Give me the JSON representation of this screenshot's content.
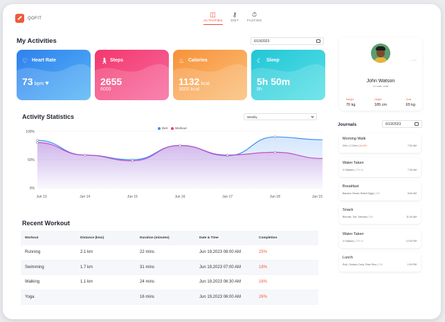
{
  "brand": {
    "name": "QOFIT"
  },
  "nav": [
    {
      "label": "ACTIVITIES",
      "icon": "dumbbell-icon",
      "active": true
    },
    {
      "label": "DIET",
      "icon": "fork-knife-icon",
      "active": false
    },
    {
      "label": "FASTING",
      "icon": "stopwatch-icon",
      "active": false
    }
  ],
  "activities": {
    "title": "My Activities",
    "date": "6/19/2023",
    "cards": [
      {
        "label": "Heart Rate",
        "value": "73",
        "unit": "bpm",
        "sub": "",
        "icon": "heart-icon",
        "color1": "#2f80ed",
        "color2": "#56b6f7"
      },
      {
        "label": "Steps",
        "value": "2655",
        "unit": "",
        "sub": "6000",
        "icon": "walking-icon",
        "color1": "#f2386e",
        "color2": "#f86aa0"
      },
      {
        "label": "Calories",
        "value": "1132",
        "unit": "kcal",
        "sub": "3000 kcal",
        "icon": "flame-icon",
        "color1": "#f7923a",
        "color2": "#fbc07a"
      },
      {
        "label": "Sleep",
        "value": "5h 50m",
        "unit": "",
        "sub": "8h",
        "icon": "moon-icon",
        "color1": "#22c6d6",
        "color2": "#58e0e6"
      }
    ]
  },
  "stats": {
    "title": "Activity Statistics",
    "period": "Weekly"
  },
  "chart_data": {
    "type": "area",
    "categories": [
      "Jun 13",
      "Jun 14",
      "Jun 15",
      "Jun 16",
      "Jun 17",
      "Jun 18",
      "Jun 15"
    ],
    "series": [
      {
        "name": "Diet",
        "color": "#3d8ff0",
        "values": [
          84,
          58,
          50,
          75,
          57,
          90,
          85
        ]
      },
      {
        "name": "Workout",
        "color": "#c44cc7",
        "values": [
          80,
          58,
          48,
          75,
          58,
          63,
          52
        ]
      }
    ],
    "y_ticks": [
      "100%",
      "50%",
      "0%"
    ],
    "ylim": [
      0,
      100
    ]
  },
  "workout": {
    "title": "Recent Workout",
    "columns": [
      "Workout",
      "Distance (kms)",
      "Duration (minutes)",
      "Date & Time",
      "Completion"
    ],
    "rows": [
      {
        "workout": "Running",
        "distance": "2.1 km",
        "duration": "22 mins",
        "datetime": "Jun 19,2023 08:00 AM",
        "completion": "25%"
      },
      {
        "workout": "Swimming",
        "distance": "1.7 km",
        "duration": "31 mins",
        "datetime": "Jun 19,2023 07:00 AM",
        "completion": "18%"
      },
      {
        "workout": "Walking",
        "distance": "1.1 km",
        "duration": "24 mins",
        "datetime": "Jun 19,2023 06:30 AM",
        "completion": "16%"
      },
      {
        "workout": "Yoga",
        "distance": "",
        "duration": "16 mins",
        "datetime": "Jun 19,2023 06:00 AM",
        "completion": "26%"
      }
    ]
  },
  "profile": {
    "name": "John Watson",
    "subtitle": "24 male, India",
    "more": "···",
    "stats": [
      {
        "label": "Weight",
        "value": "70 kg"
      },
      {
        "label": "Height",
        "value": "185 cm"
      },
      {
        "label": "Goal",
        "value": "65 kg"
      }
    ]
  },
  "journals": {
    "title": "Journals",
    "date": "6/19/2023",
    "items": [
      {
        "name": "Morning Walk",
        "detail_a": "30m | 2.12km | ",
        "detail_b": "44.4%",
        "detail_c": "",
        "time": "7:00 AM"
      },
      {
        "name": "Water Taken",
        "detail_a": "3 Glasses | ",
        "detail_b": "",
        "detail_c": "750 ml",
        "time": "7:30 AM"
      },
      {
        "name": "Breakfast",
        "detail_a": "Banana, Bread, Boiled Eggs | ",
        "detail_b": "",
        "detail_c": "254",
        "time": "8:00 AM"
      },
      {
        "name": "Snack",
        "detail_a": "Biscuits, Tea, Samosa | ",
        "detail_b": "",
        "detail_c": "254",
        "time": "11:00 AM"
      },
      {
        "name": "Water Taken",
        "detail_a": "4 Glasses | ",
        "detail_b": "",
        "detail_c": "750 ml",
        "time": "12:00 PM"
      },
      {
        "name": "Lunch",
        "detail_a": "Roti, Chicken Curry, Plain Rice | ",
        "detail_b": "",
        "detail_c": "254",
        "time": "1:00 PM"
      }
    ]
  }
}
